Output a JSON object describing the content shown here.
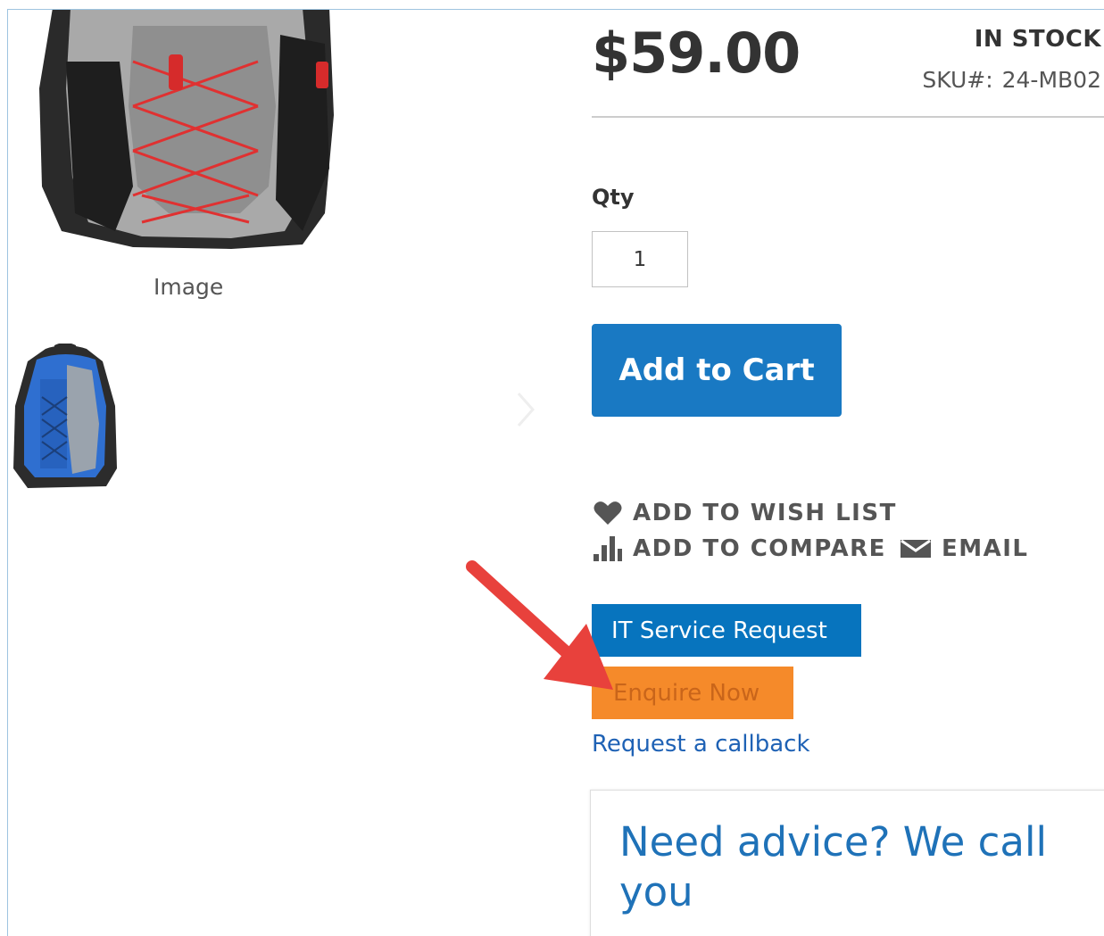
{
  "gallery": {
    "main_image_caption": "Image",
    "main_image_icon": "backpack-gray-red-image",
    "thumbnail_icon": "backpack-blue-image",
    "next_icon": "chevron-right-icon"
  },
  "product": {
    "price": "$59.00",
    "stock_status": "IN STOCK",
    "sku_label": "SKU#:",
    "sku_value": "24-MB02"
  },
  "purchase": {
    "qty_label": "Qty",
    "qty_value": "1",
    "add_to_cart_label": "Add to Cart"
  },
  "actions": {
    "wishlist_label": "ADD TO WISH LIST",
    "compare_label": "ADD TO COMPARE",
    "email_label": "EMAIL"
  },
  "extra_buttons": {
    "it_service_label": "IT Service Request",
    "enquire_label": "Enquire Now",
    "callback_label": "Request a callback"
  },
  "advice": {
    "title": "Need advice? We call you"
  },
  "colors": {
    "primary_blue": "#1979c3",
    "it_service_blue": "#0774be",
    "enquire_orange": "#f58a2a",
    "annotation_arrow": "#e8413c",
    "link_blue": "#1f62b5"
  }
}
